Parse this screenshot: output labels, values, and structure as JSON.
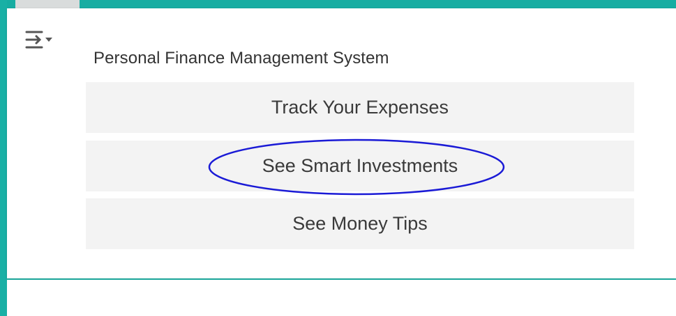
{
  "icons": {
    "menu": "collapse-expand-menu-icon"
  },
  "colors": {
    "background_teal": "#1cb4a8",
    "highlight_ellipse": "#1a1ad6"
  },
  "menu": {
    "title": "Personal Finance Management System",
    "options": [
      {
        "label": "Track Your Expenses"
      },
      {
        "label": "See Smart Investments",
        "highlighted": true
      },
      {
        "label": "See Money Tips"
      }
    ]
  }
}
